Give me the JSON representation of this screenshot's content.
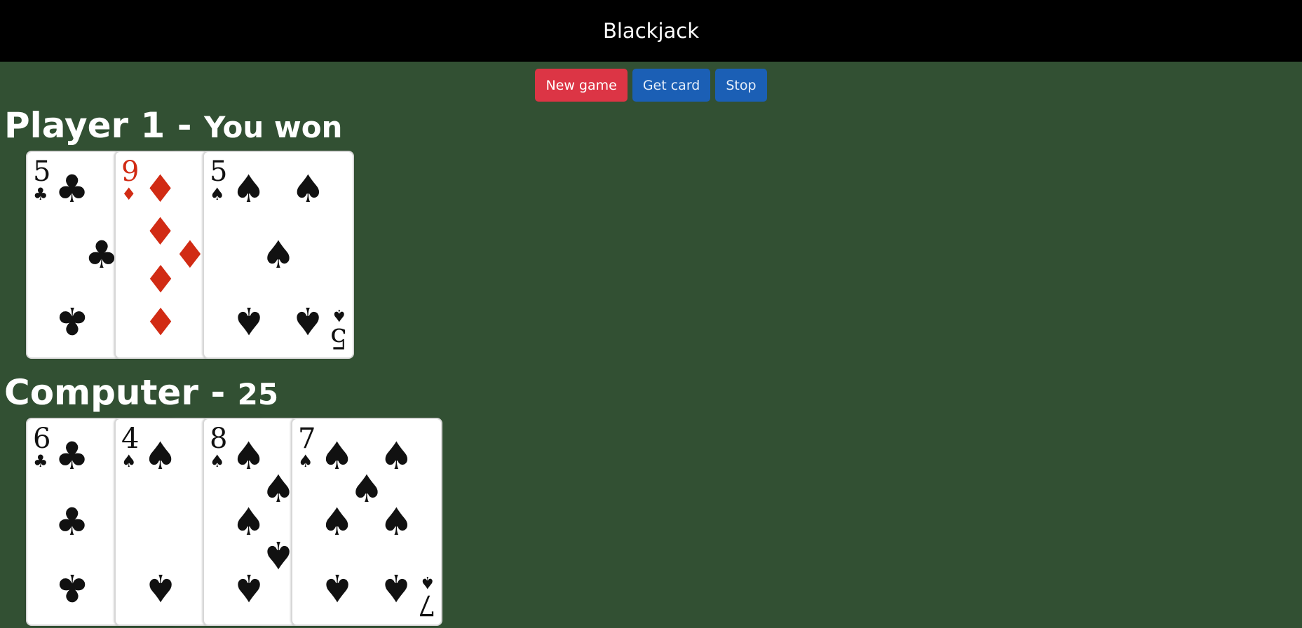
{
  "app": {
    "title": "Blackjack"
  },
  "controls": {
    "new_game": "New game",
    "get_card": "Get card",
    "stop": "Stop"
  },
  "player": {
    "name": "Player 1",
    "separator": "-",
    "status": "You won",
    "cards": [
      {
        "rank": "5",
        "suit": "clubs",
        "symbol": "♣",
        "color": "black"
      },
      {
        "rank": "9",
        "suit": "diamonds",
        "symbol": "♦",
        "color": "red"
      },
      {
        "rank": "5",
        "suit": "spades",
        "symbol": "♠",
        "color": "black"
      }
    ]
  },
  "computer": {
    "name": "Computer",
    "separator": "-",
    "status": "25",
    "cards": [
      {
        "rank": "6",
        "suit": "clubs",
        "symbol": "♣",
        "color": "black"
      },
      {
        "rank": "4",
        "suit": "spades",
        "symbol": "♠",
        "color": "black"
      },
      {
        "rank": "8",
        "suit": "spades",
        "symbol": "♠",
        "color": "black"
      },
      {
        "rank": "7",
        "suit": "spades",
        "symbol": "♠",
        "color": "black"
      }
    ]
  },
  "colors": {
    "table": "#325033",
    "header": "#000000",
    "new_game_button": "#dc3545",
    "action_button": "#1b5fb5",
    "red_suit": "#d12b14",
    "black_suit": "#111111"
  }
}
